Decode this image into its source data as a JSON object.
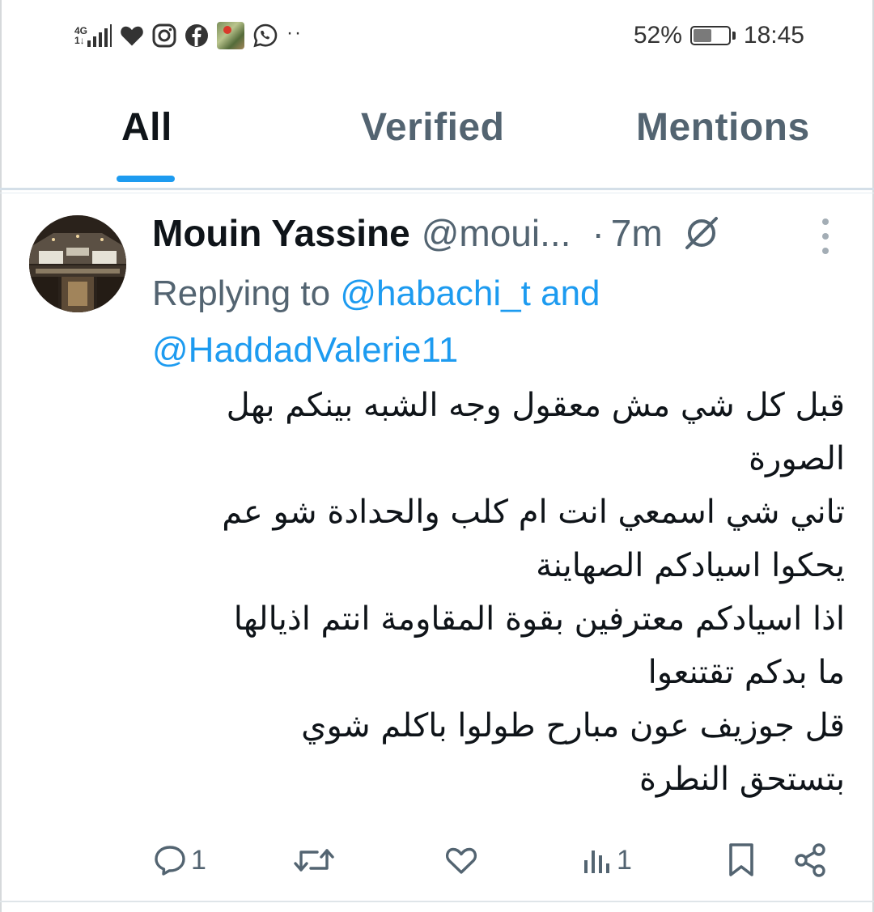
{
  "status_bar": {
    "network_type": "4G",
    "network_sub": "1↓",
    "battery_percent": "52%",
    "battery_level": 0.52,
    "time": "18:45",
    "dots": "··",
    "icons": [
      "signal-icon",
      "heart-icon",
      "instagram-icon",
      "facebook-icon",
      "photo-thumbnail",
      "whatsapp-icon",
      "more-notifications-icon"
    ]
  },
  "tabs": [
    {
      "label": "All",
      "active": true
    },
    {
      "label": "Verified",
      "active": false
    },
    {
      "label": "Mentions",
      "active": false
    }
  ],
  "tweet": {
    "display_name": "Mouin Yassine",
    "handle": "@moui...",
    "separator": "·",
    "timestamp": "7m",
    "reply_prefix": "Replying to",
    "reply_mention_1": "@habachi_t",
    "reply_and": "and",
    "reply_mention_2": "@HaddadValerie11",
    "body_lines": [
      "قبل كل شي مش معقول وجه الشبه بينكم بهل",
      "الصورة",
      "تاني شي اسمعي انت ام كلب والحدادة شو عم",
      "يحكوا اسيادكم الصهاينة",
      "اذا اسيادكم معترفين بقوة المقاومة انتم اذيالها",
      "ما بدكم تقتنعوا",
      "قل جوزيف عون مبارح طولوا باكلم شوي",
      "بتستحق النطرة"
    ],
    "actions": {
      "reply_count": "1",
      "retweet_count": "",
      "like_count": "",
      "views_count": "1"
    }
  },
  "colors": {
    "accent": "#1d9bf0",
    "secondary_text": "#536471",
    "primary_text": "#0f1419"
  }
}
